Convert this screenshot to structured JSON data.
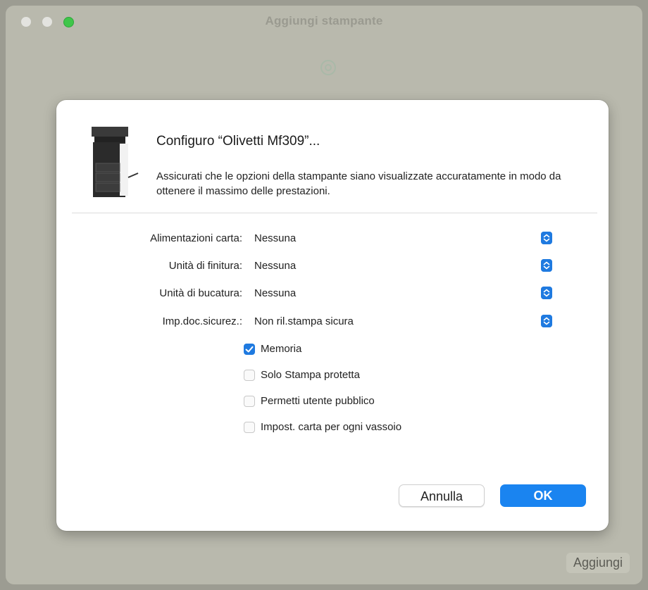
{
  "window": {
    "title": "Aggiungi stampante",
    "add_button_label": "Aggiungi"
  },
  "sheet": {
    "title": "Configuro “Olivetti Mf309”...",
    "description": "Assicurati che le opzioni della stampante siano visualizzate accuratamente in modo da ottenere il massimo delle prestazioni.",
    "options": [
      {
        "label": "Alimentazioni carta:",
        "value": "Nessuna"
      },
      {
        "label": "Unità di finitura:",
        "value": "Nessuna"
      },
      {
        "label": "Unità di bucatura:",
        "value": "Nessuna"
      },
      {
        "label": "Imp.doc.sicurez.:",
        "value": "Non ril.stampa sicura"
      }
    ],
    "checkboxes": [
      {
        "label": "Memoria",
        "checked": true
      },
      {
        "label": "Solo Stampa protetta",
        "checked": false
      },
      {
        "label": "Permetti utente pubblico",
        "checked": false
      },
      {
        "label": "Impost. carta per ogni vassoio",
        "checked": false
      }
    ],
    "buttons": {
      "cancel": "Annulla",
      "ok": "OK"
    }
  },
  "colors": {
    "accent": "#1a84f0",
    "window_bg": "#b9b9ad",
    "traffic_zoom": "#3fc64a"
  },
  "icons": {
    "toolbar": "printer-settings-icon",
    "popup": "stepper-updown-icon",
    "checkbox_checked": "checkmark-icon"
  }
}
